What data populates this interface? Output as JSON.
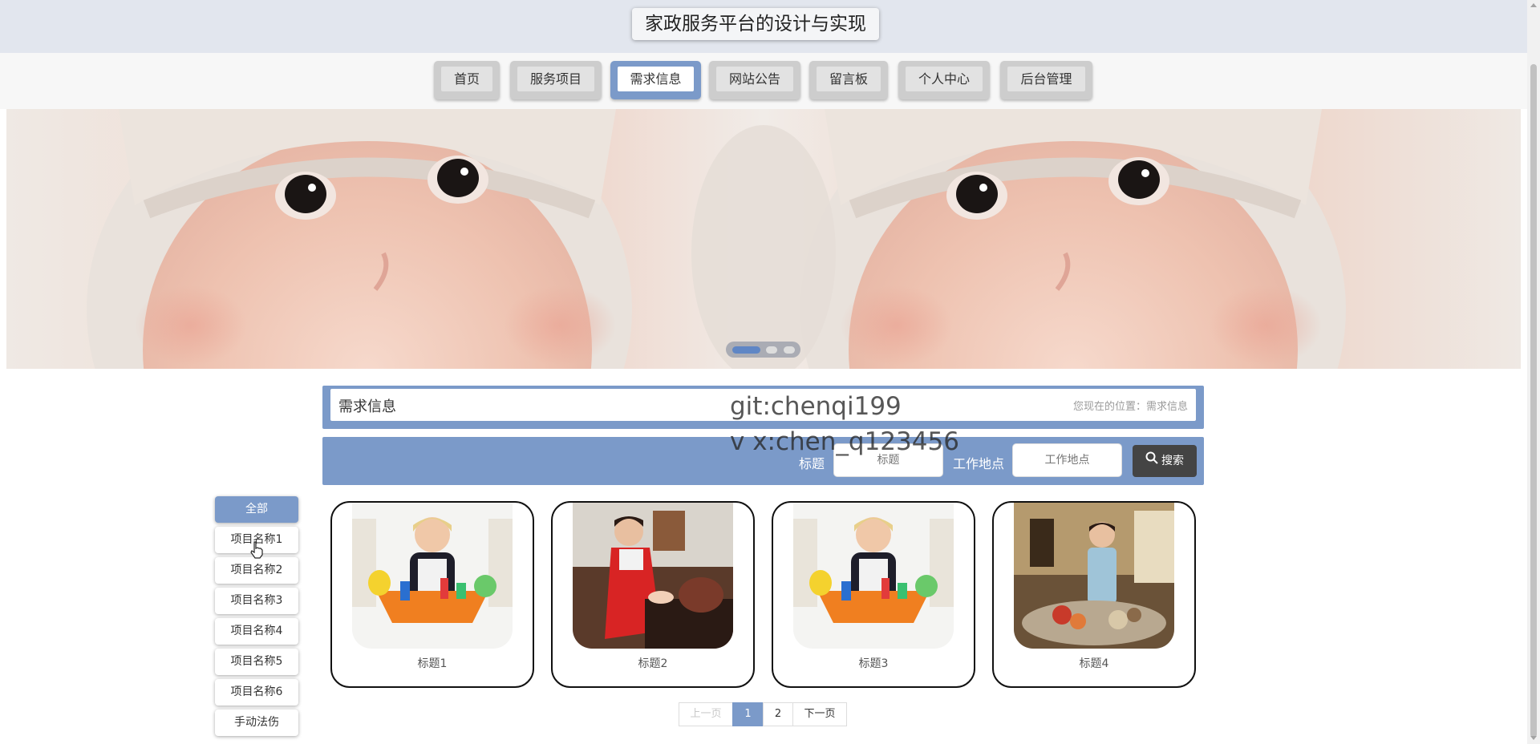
{
  "header": {
    "site_title": "家政服务平台的设计与实现"
  },
  "nav": {
    "items": [
      {
        "label": "首页"
      },
      {
        "label": "服务项目"
      },
      {
        "label": "需求信息",
        "active": true
      },
      {
        "label": "网站公告"
      },
      {
        "label": "留言板"
      },
      {
        "label": "个人中心"
      },
      {
        "label": "后台管理"
      }
    ]
  },
  "banner": {
    "slide_count": 3,
    "active_slide": 1
  },
  "page": {
    "title": "需求信息",
    "location": "您现在的位置：需求信息"
  },
  "search": {
    "title_label": "标题",
    "title_placeholder": "标题",
    "location_label": "工作地点",
    "location_placeholder": "工作地点",
    "button_label": "搜索"
  },
  "categories": [
    {
      "label": "全部",
      "active": true
    },
    {
      "label": "项目名称1"
    },
    {
      "label": "项目名称2"
    },
    {
      "label": "项目名称3"
    },
    {
      "label": "项目名称4"
    },
    {
      "label": "项目名称5"
    },
    {
      "label": "项目名称6"
    },
    {
      "label": "手动法伤"
    }
  ],
  "cards": [
    {
      "title": "标题1"
    },
    {
      "title": "标题2"
    },
    {
      "title": "标题3"
    },
    {
      "title": "标题4"
    }
  ],
  "pagination": {
    "prev": "上一页",
    "pages": [
      "1",
      "2"
    ],
    "current": "1",
    "next": "下一页"
  },
  "watermark": {
    "line1": "git:chenqi199",
    "line2": "v x:chen_q123456"
  },
  "colors": {
    "accent": "#7b9ac9",
    "search_button": "#444444",
    "header_bg": "#e2e6ee"
  }
}
